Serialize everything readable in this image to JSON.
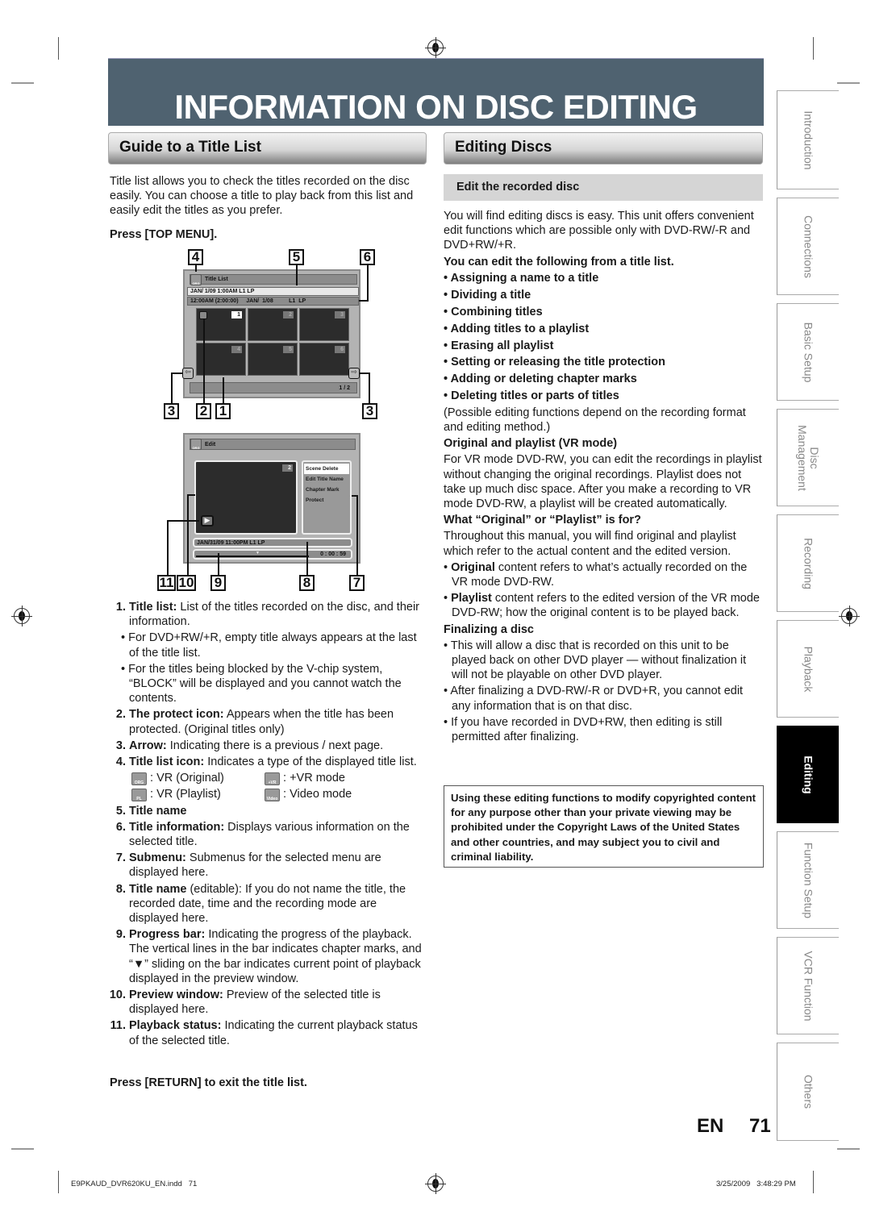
{
  "page": {
    "title": "INFORMATION ON DISC EDITING",
    "language": "EN",
    "page_number": "71",
    "footer_file": "E9PKAUD_DVR620KU_EN.indd   71",
    "footer_date": "3/25/2009   3:48:29 PM"
  },
  "left": {
    "section_title": "Guide to a Title List",
    "intro": "Title list allows you to check the titles recorded on the disc easily. You can choose a title to play back from this list and easily edit the titles as you prefer.",
    "press_top_menu": "Press [TOP MENU].",
    "title_list_screen": {
      "header": "Title List",
      "icon_label": "ORG",
      "title_name_row": "JAN/ 1/09 1:00AM  L1  LP",
      "title_info_row": "12:00AM (2:00:00)     JAN/  1/08          L1  LP",
      "thumbnails": [
        "1",
        "2",
        "3",
        "4",
        "5",
        "6"
      ],
      "selected_thumbnail": "1",
      "page_indicator": "1 / 2",
      "callouts_top": [
        "4",
        "5",
        "6"
      ],
      "callouts_bottom": [
        "3",
        "2",
        "1",
        "3"
      ]
    },
    "edit_screen": {
      "header": "Edit",
      "icon_label": "ORG",
      "preview_number": "2",
      "submenu": [
        "Scene Delete",
        "Edit Title Name",
        "Chapter Mark",
        "Protect"
      ],
      "selected_submenu": "Scene Delete",
      "title_row": "JAN/31/09 11:00PM L1 LP",
      "time": "0 : 00 : 59",
      "callouts": [
        "11",
        "10",
        "9",
        "8",
        "7"
      ]
    },
    "items": [
      {
        "n": "1.",
        "term": "Title list:",
        "text": " List of the titles recorded on the disc, and their information."
      },
      {
        "bullet": "For DVD+RW/+R, empty title always appears at the last of the title list."
      },
      {
        "bullet": "For the titles being blocked by the V-chip system, “BLOCK” will be displayed and you cannot watch the contents."
      },
      {
        "n": "2.",
        "term": "The protect icon:",
        "text": " Appears when the title has been protected. (Original titles only)"
      },
      {
        "n": "3.",
        "term": "Arrow:",
        "text": " Indicating there is a previous / next page."
      },
      {
        "n": "4.",
        "term": "Title list icon:",
        "text": " Indicates a type of the displayed title list."
      }
    ],
    "icon_legend": [
      {
        "icon": "ORG",
        "label": ": VR (Original)"
      },
      {
        "icon": "+VR",
        "label": ": +VR mode"
      },
      {
        "icon": "PL",
        "label": ": VR (Playlist)"
      },
      {
        "icon": "Video",
        "label": ": Video mode"
      }
    ],
    "items2": [
      {
        "n": "5.",
        "term": "Title name",
        "text": ""
      },
      {
        "n": "6.",
        "term": "Title information:",
        "text": " Displays various information on the selected title."
      },
      {
        "n": "7.",
        "term": "Submenu:",
        "text": " Submenus for the selected menu are displayed here."
      },
      {
        "n": "8.",
        "term": "Title name",
        "text": " (editable): If you do not name the title, the recorded date, time and the recording mode are displayed here."
      },
      {
        "n": "9.",
        "term": "Progress bar:",
        "text": " Indicating the progress of the playback. The vertical lines in the bar indicates chapter marks, and “▼” sliding on the bar indicates current point of playback displayed in the preview window."
      },
      {
        "n": "10.",
        "term": "Preview window:",
        "text": " Preview of the selected title is displayed here."
      },
      {
        "n": "11.",
        "term": "Playback status:",
        "text": " Indicating the current playback status of the selected title."
      }
    ],
    "press_return": "Press [RETURN] to exit the title list."
  },
  "right": {
    "section_title": "Editing Discs",
    "subhead": "Edit the recorded disc",
    "intro": "You will find editing discs is easy. This unit offers convenient edit functions which are possible only with DVD-RW/-R and DVD+RW/+R.",
    "can_edit_heading": "You can edit the following from a title list.",
    "edit_functions": [
      "Assigning a name to a title",
      "Dividing a title",
      "Combining titles",
      "Adding titles to a playlist",
      "Erasing all playlist",
      "Setting or releasing the title protection",
      "Adding or deleting chapter marks",
      "Deleting titles or parts of titles"
    ],
    "note": "(Possible editing functions depend on the recording format and editing method.)",
    "orig_heading": "Original and playlist (VR mode)",
    "orig_text": "For VR mode DVD-RW, you can edit the recordings in playlist without changing the original recordings. Playlist does not take up much disc space. After you make a recording to VR mode DVD-RW, a playlist will be created automatically.",
    "what_heading": "What “Original” or “Playlist” is for?",
    "what_text": "Throughout this manual, you will find original and playlist which refer to the actual content and the edited version.",
    "what_bullets": [
      {
        "term": "Original",
        "text": " content refers to what’s actually recorded on the VR mode DVD-RW."
      },
      {
        "term": "Playlist",
        "text": " content refers to the edited version of the VR mode DVD-RW; how the original content is to be played back."
      }
    ],
    "final_heading": "Finalizing a disc",
    "final_bullets": [
      "This will allow a disc that is recorded on this unit to be played back on other DVD player — without finalization it will not be playable on other DVD player.",
      "After finalizing a DVD-RW/-R or DVD+R, you cannot edit any information that is on that disc.",
      "If you have recorded in DVD+RW, then editing is still permitted after finalizing."
    ],
    "legal": "Using these editing functions to modify copyrighted content for any purpose other than your private viewing may be prohibited under the Copyright Laws of the United States and other countries, and may subject you to civil and criminal liability."
  },
  "side_tabs": [
    {
      "label": "Introduction",
      "active": false
    },
    {
      "label": "Connections",
      "active": false
    },
    {
      "label": "Basic Setup",
      "active": false
    },
    {
      "label": "Disc Management",
      "active": false
    },
    {
      "label": "Recording",
      "active": false
    },
    {
      "label": "Playback",
      "active": false
    },
    {
      "label": "Editing",
      "active": true
    },
    {
      "label": "Function Setup",
      "active": false
    },
    {
      "label": "VCR Function",
      "active": false
    },
    {
      "label": "Others",
      "active": false
    }
  ],
  "colors": {
    "banner": "#4f6270",
    "active_tab": "#000000",
    "subhead_bg": "#d5d5d5"
  }
}
